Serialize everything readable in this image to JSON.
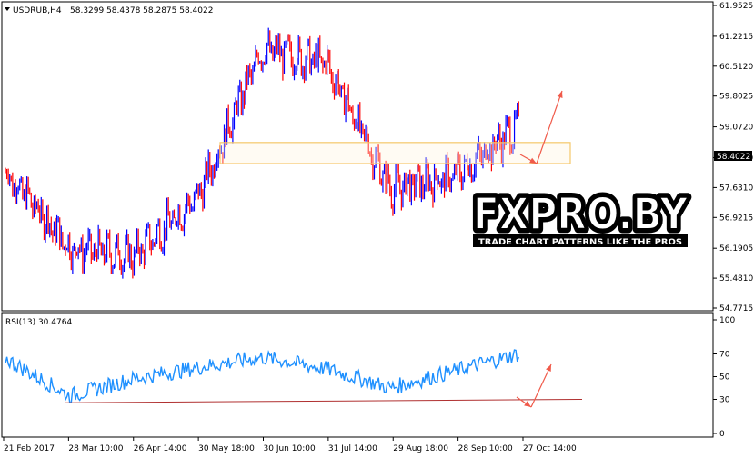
{
  "header": {
    "symbol_tf": "USDRUB,H4",
    "ohlc": "58.3299 58.4378 58.2875 58.4022"
  },
  "rsi_header": "RSI(13) 30.4764",
  "price_tag": "58.4022",
  "watermark": {
    "logo": "FXPRO.BY",
    "tagline": "TRADE CHART PATTERNS LIKE THE PROS"
  },
  "colors": {
    "bull": "#0000ff",
    "bear": "#ff0000",
    "rsi_line": "#1e90ff",
    "zone_border": "#f5c76a",
    "trend_line": "#b03030",
    "arrow": "#f05a4a",
    "tag_bg": "#000000",
    "tag_text": "#ffffff"
  },
  "chart_data": [
    {
      "type": "line",
      "title": "USDRUB,H4",
      "subtitle": "58.3299 58.4378 58.2875 58.4022",
      "xlabel": "",
      "ylabel": "",
      "ylim": [
        54.7715,
        61.9525
      ],
      "y_ticks": [
        "61.9525",
        "61.2215",
        "60.5120",
        "59.8025",
        "59.0720",
        "58.3410",
        "57.6310",
        "56.9215",
        "56.1905",
        "55.4810",
        "54.7715"
      ],
      "x_ticks": [
        "21 Feb 2017",
        "28 Mar 10:00",
        "26 Apr 14:00",
        "30 May 18:00",
        "30 Jun 10:00",
        "31 Jul 14:00",
        "29 Aug 18:00",
        "28 Sep 10:00",
        "27 Oct 14:00"
      ],
      "last_price": 58.4022,
      "x": [
        "21 Feb 2017",
        "28 Mar 10:00",
        "26 Apr 14:00",
        "30 May 18:00",
        "30 Jun 10:00",
        "31 Jul 14:00",
        "29 Aug 18:00",
        "28 Sep 10:00",
        "27 Oct 14:00"
      ],
      "series": [
        {
          "values": [
            58.0,
            56.2,
            56.0,
            57.4,
            60.9,
            60.6,
            57.6,
            57.9,
            59.1
          ]
        }
      ],
      "zone": [
        58.2,
        58.7
      ],
      "grid": false,
      "legend": "none"
    },
    {
      "type": "line",
      "title": "RSI(13) 30.4764",
      "xlabel": "",
      "ylabel": "",
      "ylim": [
        0,
        100
      ],
      "y_ticks": [
        "100",
        "70",
        "50",
        "30",
        "0"
      ],
      "x": [
        "21 Feb 2017",
        "28 Mar 10:00",
        "26 Apr 14:00",
        "30 May 18:00",
        "30 Jun 10:00",
        "31 Jul 14:00",
        "29 Aug 18:00",
        "28 Sep 10:00",
        "27 Oct 14:00"
      ],
      "series": [
        {
          "values": [
            66,
            33,
            48,
            58,
            67,
            57,
            40,
            55,
            70
          ]
        }
      ],
      "last_value": 30.4764,
      "grid": false,
      "legend": "none"
    }
  ]
}
